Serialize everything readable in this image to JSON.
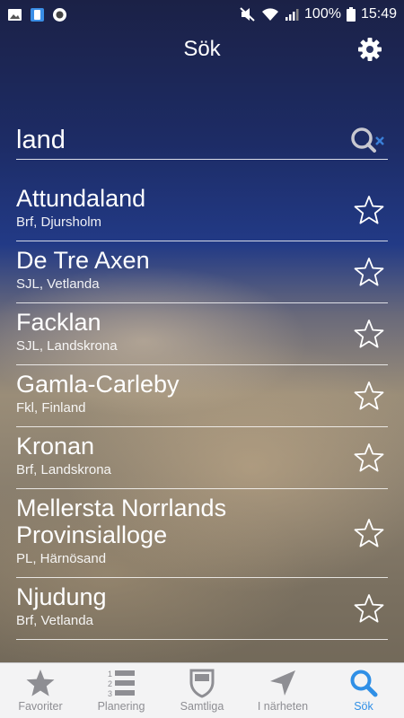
{
  "status_bar": {
    "battery": "100%",
    "time": "15:49"
  },
  "header": {
    "title": "Sök"
  },
  "search": {
    "value": "land",
    "placeholder": ""
  },
  "results": [
    {
      "name": "Attundaland",
      "sub": "Brf, Djursholm"
    },
    {
      "name": "De Tre Axen",
      "sub": "SJL, Vetlanda"
    },
    {
      "name": "Facklan",
      "sub": "SJL, Landskrona"
    },
    {
      "name": "Gamla-Carleby",
      "sub": "Fkl, Finland"
    },
    {
      "name": "Kronan",
      "sub": "Brf, Landskrona"
    },
    {
      "name": "Mellersta Norrlands Provinsialloge",
      "sub": "PL, Härnösand"
    },
    {
      "name": "Njudung",
      "sub": "Brf, Vetlanda"
    }
  ],
  "tabs": [
    {
      "label": "Favoriter",
      "icon": "star-icon"
    },
    {
      "label": "Planering",
      "icon": "numbered-list-icon"
    },
    {
      "label": "Samtliga",
      "icon": "shield-icon"
    },
    {
      "label": "I närheten",
      "icon": "location-arrow-icon"
    },
    {
      "label": "Sök",
      "icon": "search-icon",
      "active": true
    }
  ],
  "colors": {
    "active_tab": "#2f8fe6",
    "inactive_tab": "#8e8e93",
    "tabbar_bg": "#f3f3f4"
  }
}
